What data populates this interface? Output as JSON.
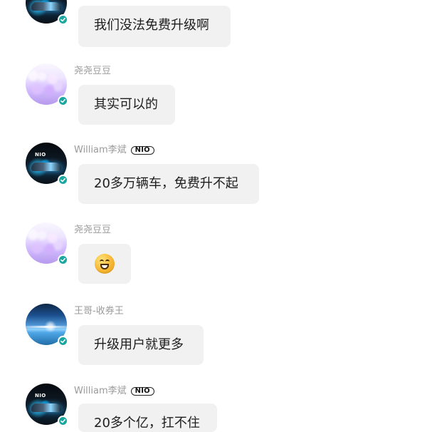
{
  "messages": [
    {
      "text": "我们没法免费升级啊",
      "avatar": "nio-car-avatar",
      "verified": true
    },
    {
      "name": "尧尧豆豆",
      "text": "其实可以的",
      "avatar": "flower-avatar",
      "verified": true
    },
    {
      "name": "William李斌",
      "badge": "NIO",
      "text": "20多万辆车，免费升不起",
      "avatar": "nio-car-avatar",
      "verified": true
    },
    {
      "name": "尧尧豆豆",
      "avatar": "flower-avatar",
      "verified": true,
      "emoji": "grinning-face"
    },
    {
      "name": "王哥-收券王",
      "text": "升级用户就更多",
      "avatar": "sea-avatar",
      "verified": true
    },
    {
      "name": "William李斌",
      "badge": "NIO",
      "text": "20多个亿，扛不住",
      "avatar": "nio-car-avatar",
      "verified": true
    }
  ],
  "icons": {
    "verified": "check-icon",
    "emoji": "grinning-face-emoji"
  },
  "colors": {
    "background": "#ffffff",
    "bubble": "#f1f1f1",
    "name": "#9a9a9a",
    "verified": "#1aa7a0"
  }
}
